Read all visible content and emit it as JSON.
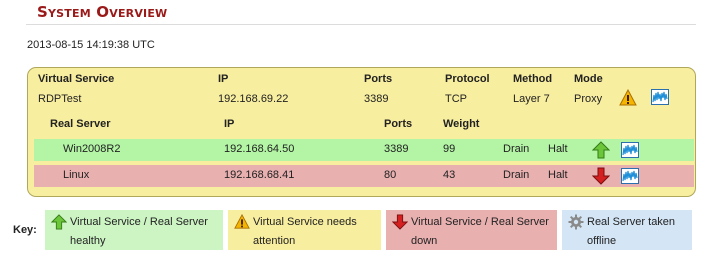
{
  "page": {
    "title": "System Overview",
    "timestamp": "2013-08-15 14:19:38 UTC"
  },
  "virtual_service": {
    "headers": {
      "name": "Virtual Service",
      "ip": "IP",
      "ports": "Ports",
      "protocol": "Protocol",
      "method": "Method",
      "mode": "Mode"
    },
    "name": "RDPTest",
    "ip": "192.168.69.22",
    "ports": "3389",
    "protocol": "TCP",
    "method": "Layer 7",
    "mode": "Proxy",
    "status_icon": "warning-icon",
    "stats_icon": "statistics-graph-icon"
  },
  "real_servers": {
    "headers": {
      "name": "Real Server",
      "ip": "IP",
      "ports": "Ports",
      "weight": "Weight"
    },
    "rows": [
      {
        "name": "Win2008R2",
        "ip": "192.168.64.50",
        "ports": "3389",
        "weight": "99",
        "drain": "Drain",
        "halt": "Halt",
        "status_icon": "green-up-arrow-icon",
        "stats_icon": "statistics-graph-icon",
        "row_color": "#b3f5a5"
      },
      {
        "name": "Linux",
        "ip": "192.168.68.41",
        "ports": "80",
        "weight": "43",
        "drain": "Drain",
        "halt": "Halt",
        "status_icon": "red-down-arrow-icon",
        "stats_icon": "statistics-graph-icon",
        "row_color": "#e9b0b0"
      }
    ]
  },
  "key": {
    "label": "Key:",
    "items": [
      {
        "text_line1": "Virtual Service / Real Server",
        "text_line2": "healthy",
        "icon": "green-up-arrow-icon",
        "color": "#cdf5c4"
      },
      {
        "text_line1": "Virtual Service needs",
        "text_line2": "attention",
        "icon": "warning-icon",
        "color": "#f8ee9f"
      },
      {
        "text_line1": "Virtual Service / Real Server",
        "text_line2": "down",
        "icon": "red-down-arrow-icon",
        "color": "#e9b0b0"
      },
      {
        "text_line1": "Real Server taken",
        "text_line2": "offline",
        "icon": "gear-icon",
        "color": "#d4e6f6"
      }
    ]
  },
  "colors": {
    "title": "#9a1a1a",
    "panel": "#f8ee9f",
    "healthy": "#b3f5a5",
    "down": "#e9b0b0"
  }
}
